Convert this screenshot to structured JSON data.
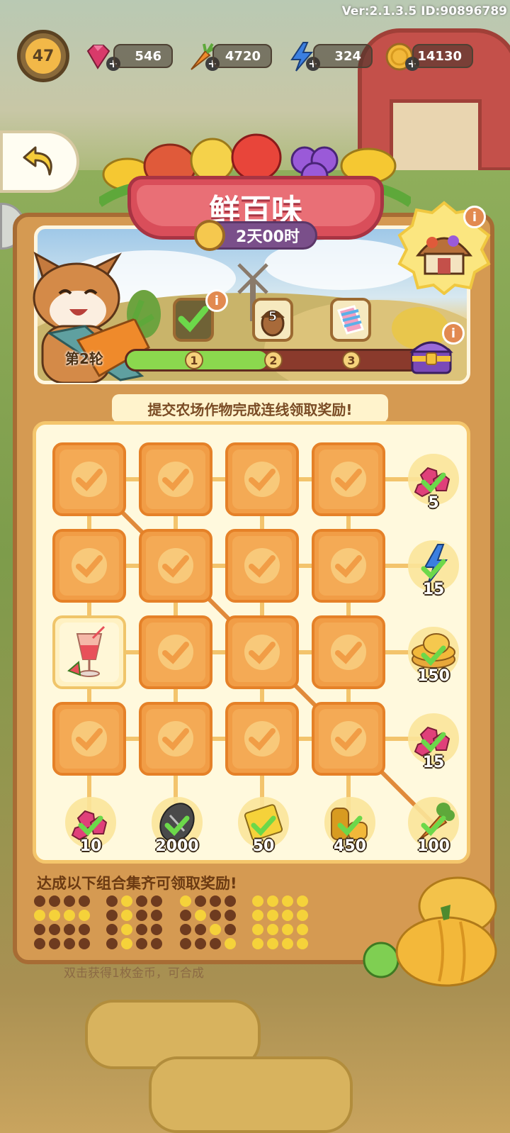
{
  "version": "Ver:2.1.3.5 ID:90896789",
  "player": {
    "level": "47"
  },
  "resources": [
    {
      "name": "gem",
      "value": "546",
      "color": "#d83a6a"
    },
    {
      "name": "carrot",
      "value": "4720",
      "color": "#ef8a2b"
    },
    {
      "name": "energy",
      "value": "324",
      "color": "#3b7fe0"
    },
    {
      "name": "coin",
      "value": "14130",
      "color": "#f2b83a"
    }
  ],
  "event": {
    "title": "鲜百味",
    "timer": "2天00时",
    "round_label": "第2轮",
    "stage_count": "5",
    "progress_nodes": [
      "1",
      "2",
      "3"
    ],
    "progress_fraction": 0.48,
    "info_symbol": "i"
  },
  "instruction": "提交农场作物完成连线领取奖励!",
  "row_rewards": [
    {
      "icon": "gem-cluster-icon",
      "value": "5"
    },
    {
      "icon": "energy-icon",
      "value": "15"
    },
    {
      "icon": "coins-icon",
      "value": "150"
    },
    {
      "icon": "gem-cluster-icon",
      "value": "15"
    }
  ],
  "col_rewards": [
    {
      "icon": "gem-cluster-icon",
      "value": "10"
    },
    {
      "icon": "seeds-icon",
      "value": "2000"
    },
    {
      "icon": "ticket-icon",
      "value": "50"
    },
    {
      "icon": "coin-stack-icon",
      "value": "450"
    },
    {
      "icon": "carrot-icon",
      "value": "100"
    }
  ],
  "grid": [
    [
      "done",
      "done",
      "done",
      "done"
    ],
    [
      "done",
      "done",
      "done",
      "done"
    ],
    [
      "juice",
      "done",
      "done",
      "done"
    ],
    [
      "done",
      "done",
      "done",
      "done"
    ]
  ],
  "combo_title": "达成以下组合集齐可领取奖励!",
  "combos": [
    [
      [
        0,
        0,
        0,
        0
      ],
      [
        1,
        1,
        1,
        1
      ],
      [
        0,
        0,
        0,
        0
      ],
      [
        0,
        0,
        0,
        0
      ]
    ],
    [
      [
        0,
        1,
        0,
        0
      ],
      [
        0,
        1,
        0,
        0
      ],
      [
        0,
        1,
        0,
        0
      ],
      [
        0,
        1,
        0,
        0
      ]
    ],
    [
      [
        1,
        0,
        0,
        0
      ],
      [
        0,
        1,
        0,
        0
      ],
      [
        0,
        0,
        1,
        0
      ],
      [
        0,
        0,
        0,
        1
      ]
    ],
    [
      [
        1,
        1,
        1,
        1
      ],
      [
        1,
        1,
        1,
        1
      ],
      [
        1,
        1,
        1,
        1
      ],
      [
        1,
        1,
        1,
        1
      ]
    ]
  ],
  "footer_tip": "双击获得1枚金币，可合成",
  "colors": {
    "tile": "#f19d46",
    "panel": "#d59a52",
    "banner": "#d94e5a",
    "dot_on": "#f5d23a",
    "dot_off": "#6e3b1f"
  }
}
